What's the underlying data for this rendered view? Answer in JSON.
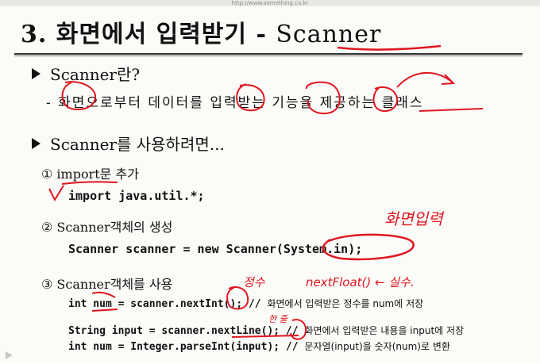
{
  "url_text": "http://www.something.co.kr",
  "title": {
    "prefix": "3. 화면에서 입력받기 - ",
    "highlight": "Scanner"
  },
  "section1": {
    "heading": "Scanner란?",
    "description": "- 화면으로부터 데이터를 입력받는 기능을 제공하는 클래스"
  },
  "section2": {
    "heading": "Scanner를 사용하려면...",
    "step1": {
      "label": "① import문 추가",
      "code": "import java.util.*;"
    },
    "step2": {
      "label": "② Scanner객체의 생성",
      "code": "Scanner scanner = new Scanner(System.in);"
    },
    "step3": {
      "label": "③ Scanner객체를 사용",
      "lines": [
        {
          "code": "int num = scanner.nextInt(); // ",
          "comment": "화면에서 입력받은 정수를 num에 저장"
        },
        {
          "code": "String input = scanner.nextLine(); // ",
          "comment": "화면에서 입력받은 내용을 input에 저장"
        },
        {
          "code": "int num = Integer.parseInt(input); // ",
          "comment": "문자열(input)을 숫자(num)로 변환"
        }
      ]
    }
  },
  "annotations": {
    "screen_input": "화면입력",
    "integer": "정수",
    "next_float": "nextFloat() ← 실수.",
    "one_line": "한 줄"
  },
  "colors": {
    "ink_red": "#e0161f",
    "text": "#111111",
    "background": "#fbfbf8"
  },
  "icons": {
    "play_control": "play-arrow-icon"
  }
}
